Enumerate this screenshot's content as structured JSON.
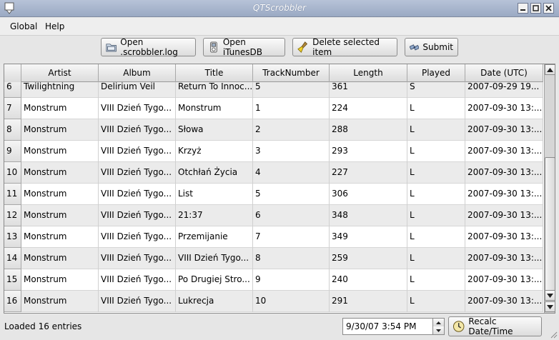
{
  "window": {
    "title": "QTScrobbler"
  },
  "menu": {
    "items": [
      "Global",
      "Help"
    ]
  },
  "toolbar": {
    "open_log": "Open .scrobbler.log",
    "open_itunes": "Open iTunesDB",
    "delete_selected": "Delete selected item",
    "submit": "Submit"
  },
  "table": {
    "columns": [
      "Artist",
      "Album",
      "Title",
      "TrackNumber",
      "Length",
      "Played",
      "Date (UTC)"
    ],
    "rows": [
      {
        "num": "6",
        "artist": "Twilightning",
        "album": "Delirium Veil",
        "title": "Return To Innoc...",
        "track": "5",
        "length": "361",
        "played": "S",
        "date": "2007-09-29 19..."
      },
      {
        "num": "7",
        "artist": "Monstrum",
        "album": "VIII Dzień Tygo...",
        "title": "Monstrum",
        "track": "1",
        "length": "224",
        "played": "L",
        "date": "2007-09-30 13:..."
      },
      {
        "num": "8",
        "artist": "Monstrum",
        "album": "VIII Dzień Tygo...",
        "title": "Słowa",
        "track": "2",
        "length": "288",
        "played": "L",
        "date": "2007-09-30 13:..."
      },
      {
        "num": "9",
        "artist": "Monstrum",
        "album": "VIII Dzień Tygo...",
        "title": "Krzyż",
        "track": "3",
        "length": "293",
        "played": "L",
        "date": "2007-09-30 13:..."
      },
      {
        "num": "10",
        "artist": "Monstrum",
        "album": "VIII Dzień Tygo...",
        "title": "Otchłań Życia",
        "track": "4",
        "length": "227",
        "played": "L",
        "date": "2007-09-30 13:..."
      },
      {
        "num": "11",
        "artist": "Monstrum",
        "album": "VIII Dzień Tygo...",
        "title": "List",
        "track": "5",
        "length": "306",
        "played": "L",
        "date": "2007-09-30 13:..."
      },
      {
        "num": "12",
        "artist": "Monstrum",
        "album": "VIII Dzień Tygo...",
        "title": "21:37",
        "track": "6",
        "length": "348",
        "played": "L",
        "date": "2007-09-30 13:..."
      },
      {
        "num": "13",
        "artist": "Monstrum",
        "album": "VIII Dzień Tygo...",
        "title": "Przemijanie",
        "track": "7",
        "length": "349",
        "played": "L",
        "date": "2007-09-30 13:..."
      },
      {
        "num": "14",
        "artist": "Monstrum",
        "album": "VIII Dzień Tygo...",
        "title": "VIII Dzień Tygo...",
        "track": "8",
        "length": "259",
        "played": "L",
        "date": "2007-09-30 13:..."
      },
      {
        "num": "15",
        "artist": "Monstrum",
        "album": "VIII Dzień Tygo...",
        "title": "Po Drugiej Stro...",
        "track": "9",
        "length": "240",
        "played": "L",
        "date": "2007-09-30 13:..."
      },
      {
        "num": "16",
        "artist": "Monstrum",
        "album": "VIII Dzień Tygo...",
        "title": "Lukrecja",
        "track": "10",
        "length": "291",
        "played": "L",
        "date": "2007-09-30 13:..."
      }
    ]
  },
  "status": {
    "text": "Loaded 16 entries",
    "datetime_value": "9/30/07 3:54 PM",
    "recalc_label": "Recalc Date/Time"
  }
}
